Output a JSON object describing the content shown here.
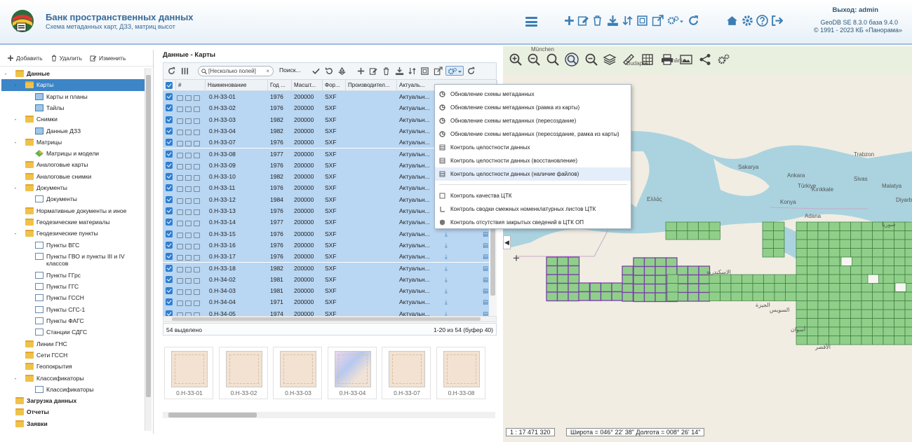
{
  "header": {
    "title": "Банк пространственных данных",
    "subtitle": "Схема метаданных карт, ДЗЗ, матриц высот",
    "logout": "Выход: admin",
    "version": "GeoDB SE 8.3.0 база 9.4.0",
    "copyright": "© 1991 - 2023 КБ «Панорама»"
  },
  "tree_toolbar": {
    "add": "Добавить",
    "delete": "Удалить",
    "edit": "Изменить"
  },
  "tree": [
    {
      "label": "Данные",
      "level": 0,
      "icon": "folder",
      "bold": true,
      "toggle": "-"
    },
    {
      "label": "Карты",
      "level": 1,
      "icon": "folder",
      "selected": true,
      "toggle": "-"
    },
    {
      "label": "Карты и планы",
      "level": 2,
      "icon": "grid"
    },
    {
      "label": "Тайлы",
      "level": 2,
      "icon": "grid"
    },
    {
      "label": "Снимки",
      "level": 1,
      "icon": "folder",
      "toggle": "-"
    },
    {
      "label": "Данные ДЗЗ",
      "level": 2,
      "icon": "grid"
    },
    {
      "label": "Матрицы",
      "level": 1,
      "icon": "folder",
      "toggle": "-"
    },
    {
      "label": "Матрицы и модели",
      "level": 2,
      "icon": "diamond"
    },
    {
      "label": "Аналоговые карты",
      "level": 1,
      "icon": "folder"
    },
    {
      "label": "Аналоговые снимки",
      "level": 1,
      "icon": "folder"
    },
    {
      "label": "Документы",
      "level": 1,
      "icon": "folder",
      "toggle": "-"
    },
    {
      "label": "Документы",
      "level": 2,
      "icon": "doc"
    },
    {
      "label": "Нормативные документы и иное",
      "level": 1,
      "icon": "folder"
    },
    {
      "label": "Геодезические материалы",
      "level": 1,
      "icon": "folder"
    },
    {
      "label": "Геодезические пункты",
      "level": 1,
      "icon": "folder",
      "toggle": "-"
    },
    {
      "label": "Пункты ВГС",
      "level": 2,
      "icon": "doc"
    },
    {
      "label": "Пункты ГВО и пункты III и IV классов",
      "level": 2,
      "icon": "doc",
      "wrap": true
    },
    {
      "label": "Пункты ГГрс",
      "level": 2,
      "icon": "doc"
    },
    {
      "label": "Пункты ГГС",
      "level": 2,
      "icon": "doc"
    },
    {
      "label": "Пункты ГССН",
      "level": 2,
      "icon": "doc"
    },
    {
      "label": "Пункты СГС-1",
      "level": 2,
      "icon": "doc"
    },
    {
      "label": "Пункты ФАГС",
      "level": 2,
      "icon": "doc"
    },
    {
      "label": "Станции СДГС",
      "level": 2,
      "icon": "doc"
    },
    {
      "label": "Линии ГНС",
      "level": 1,
      "icon": "folder"
    },
    {
      "label": "Сети ГССН",
      "level": 1,
      "icon": "folder"
    },
    {
      "label": "Геопокрытия",
      "level": 1,
      "icon": "folder"
    },
    {
      "label": "Классификаторы",
      "level": 1,
      "icon": "folder",
      "toggle": "-"
    },
    {
      "label": "Классификаторы",
      "level": 2,
      "icon": "doc"
    },
    {
      "label": "Загрузка данных",
      "level": 0,
      "icon": "folder",
      "bold": true
    },
    {
      "label": "Отчеты",
      "level": 0,
      "icon": "folder",
      "bold": true
    },
    {
      "label": "Заявки",
      "level": 0,
      "icon": "folder",
      "bold": true
    }
  ],
  "panel": {
    "title": "Данные - Карты",
    "search_placeholder": "[Несколько полей]",
    "search_clear": "×",
    "search_button": "Поиск..."
  },
  "columns": [
    "#",
    "Наименование",
    "Год ...",
    "Масшт...",
    "Фор...",
    "Производител...",
    "Актуаль..."
  ],
  "rows": [
    {
      "name": "0.Н-33-01",
      "year": "1976",
      "scale": "200000",
      "format": "SXF",
      "status": "Актуальн..."
    },
    {
      "name": "0.Н-33-02",
      "year": "1976",
      "scale": "200000",
      "format": "SXF",
      "status": "Актуальн..."
    },
    {
      "name": "0.Н-33-03",
      "year": "1982",
      "scale": "200000",
      "format": "SXF",
      "status": "Актуальн..."
    },
    {
      "name": "0.Н-33-04",
      "year": "1982",
      "scale": "200000",
      "format": "SXF",
      "status": "Актуальн..."
    },
    {
      "name": "0.Н-33-07",
      "year": "1976",
      "scale": "200000",
      "format": "SXF",
      "status": "Актуальн..."
    },
    {
      "name": "0.Н-33-08",
      "year": "1977",
      "scale": "200000",
      "format": "SXF",
      "status": "Актуальн..."
    },
    {
      "name": "0.Н-33-09",
      "year": "1976",
      "scale": "200000",
      "format": "SXF",
      "status": "Актуальн..."
    },
    {
      "name": "0.Н-33-10",
      "year": "1982",
      "scale": "200000",
      "format": "SXF",
      "status": "Актуальн..."
    },
    {
      "name": "0.Н-33-11",
      "year": "1976",
      "scale": "200000",
      "format": "SXF",
      "status": "Актуальн..."
    },
    {
      "name": "0.Н-33-12",
      "year": "1984",
      "scale": "200000",
      "format": "SXF",
      "status": "Актуальн..."
    },
    {
      "name": "0.Н-33-13",
      "year": "1976",
      "scale": "200000",
      "format": "SXF",
      "status": "Актуальн..."
    },
    {
      "name": "0.Н-33-14",
      "year": "1977",
      "scale": "200000",
      "format": "SXF",
      "status": "Актуальн..."
    },
    {
      "name": "0.Н-33-15",
      "year": "1976",
      "scale": "200000",
      "format": "SXF",
      "status": "Актуальн..."
    },
    {
      "name": "0.Н-33-16",
      "year": "1976",
      "scale": "200000",
      "format": "SXF",
      "status": "Актуальн..."
    },
    {
      "name": "0.Н-33-17",
      "year": "1976",
      "scale": "200000",
      "format": "SXF",
      "status": "Актуальн..."
    },
    {
      "name": "0.Н-33-18",
      "year": "1982",
      "scale": "200000",
      "format": "SXF",
      "status": "Актуальн..."
    },
    {
      "name": "0.Н-34-02",
      "year": "1981",
      "scale": "200000",
      "format": "SXF",
      "status": "Актуальн..."
    },
    {
      "name": "0.Н-34-03",
      "year": "1981",
      "scale": "200000",
      "format": "SXF",
      "status": "Актуальн..."
    },
    {
      "name": "0.Н-34-04",
      "year": "1971",
      "scale": "200000",
      "format": "SXF",
      "status": "Актуальн..."
    },
    {
      "name": "0.Н-34-05",
      "year": "1974",
      "scale": "200000",
      "format": "SXF",
      "status": "Актуальн..."
    }
  ],
  "footer": {
    "selected": "54 выделено",
    "paging": "1-20 из 54 (буфер 40)"
  },
  "thumbnails": [
    "0.Н-33-01",
    "0.Н-33-02",
    "0.Н-33-03",
    "0.Н-33-04",
    "0.Н-33-07",
    "0.Н-33-08"
  ],
  "menu": [
    "Обновление схемы метаданных",
    "Обновление схемы метаданных (рамка из карты)",
    "Обновление схемы метаданных (пересоздание)",
    "Обновление схемы метаданных (пересоздание, рамка из карты)",
    "Контроль целостности данных",
    "Контроль целостности данных (восстановление)",
    "Контроль целостности данных (наличие файлов)",
    "Контроль качества ЦТК",
    "Контроль сводки смежных номенклатурных листов ЦТК",
    "Контроль отсутствия закрытых сведений в ЦТК ОП"
  ],
  "map": {
    "scale": "1 : 17 471 320",
    "coords": "Широта = 046° 22' 38\" Долгота = 008° 26' 14\"",
    "places": [
      "München",
      "Budapest",
      "România",
      "Ελλάς",
      "Türkiye",
      "Ankara",
      "Sakarya",
      "Trabzon",
      "Kırıkkale",
      "Konya",
      "Adana",
      "Sivas",
      "Malatya",
      "Diyarbakır",
      "سوريا",
      "الاسكندرية",
      "الجيزة",
      "السويس",
      "أسوان",
      "الأقصر"
    ]
  },
  "colors": {
    "accent": "#3c7eb4",
    "selection": "#b9d6f2",
    "grid_fill": "#8fcf8a",
    "grid_line": "#3f7a3f",
    "purple_line": "#7a3fa8"
  }
}
